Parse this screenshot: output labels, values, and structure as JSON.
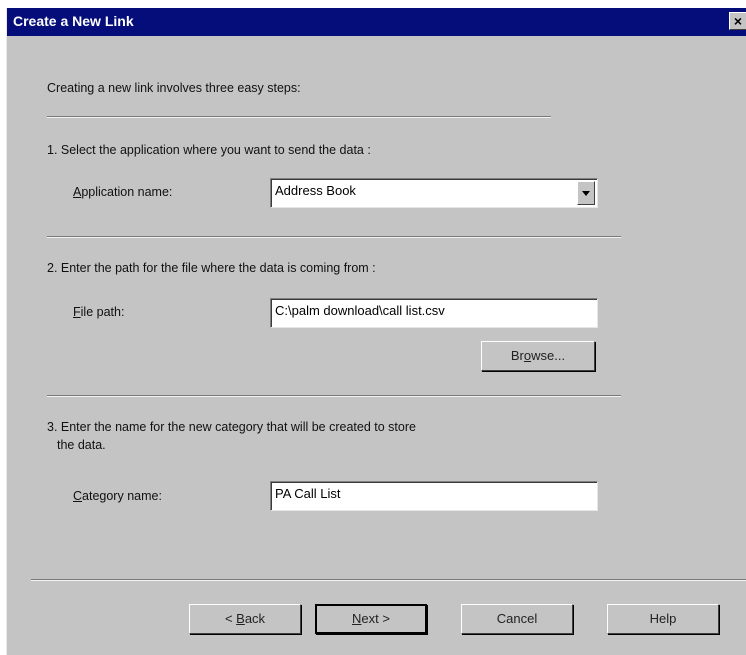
{
  "window": {
    "title": "Create a New Link",
    "close_glyph": "×"
  },
  "intro": "Creating a new link involves three easy steps:",
  "step1": {
    "instruction": "1.  Select the application where you want to send the data :",
    "label_first": "A",
    "label_rest": "pplication name:",
    "value": "Address Book"
  },
  "step2": {
    "instruction": "2.  Enter the path for the file where the data is coming from :",
    "label_first": "F",
    "label_rest": "ile path:",
    "value": "C:\\palm download\\call list.csv",
    "browse_pre": "Br",
    "browse_ul": "o",
    "browse_post": "wse..."
  },
  "step3": {
    "instruction_line1": "3. Enter the name for the new category that will be created to store",
    "instruction_line2": "the data.",
    "label_first": "C",
    "label_rest": "ategory name:",
    "value": "PA Call List"
  },
  "buttons": {
    "back_pre": "< ",
    "back_ul": "B",
    "back_post": "ack",
    "next_ul": "N",
    "next_post": "ext >",
    "cancel": "Cancel",
    "help": "Help"
  }
}
